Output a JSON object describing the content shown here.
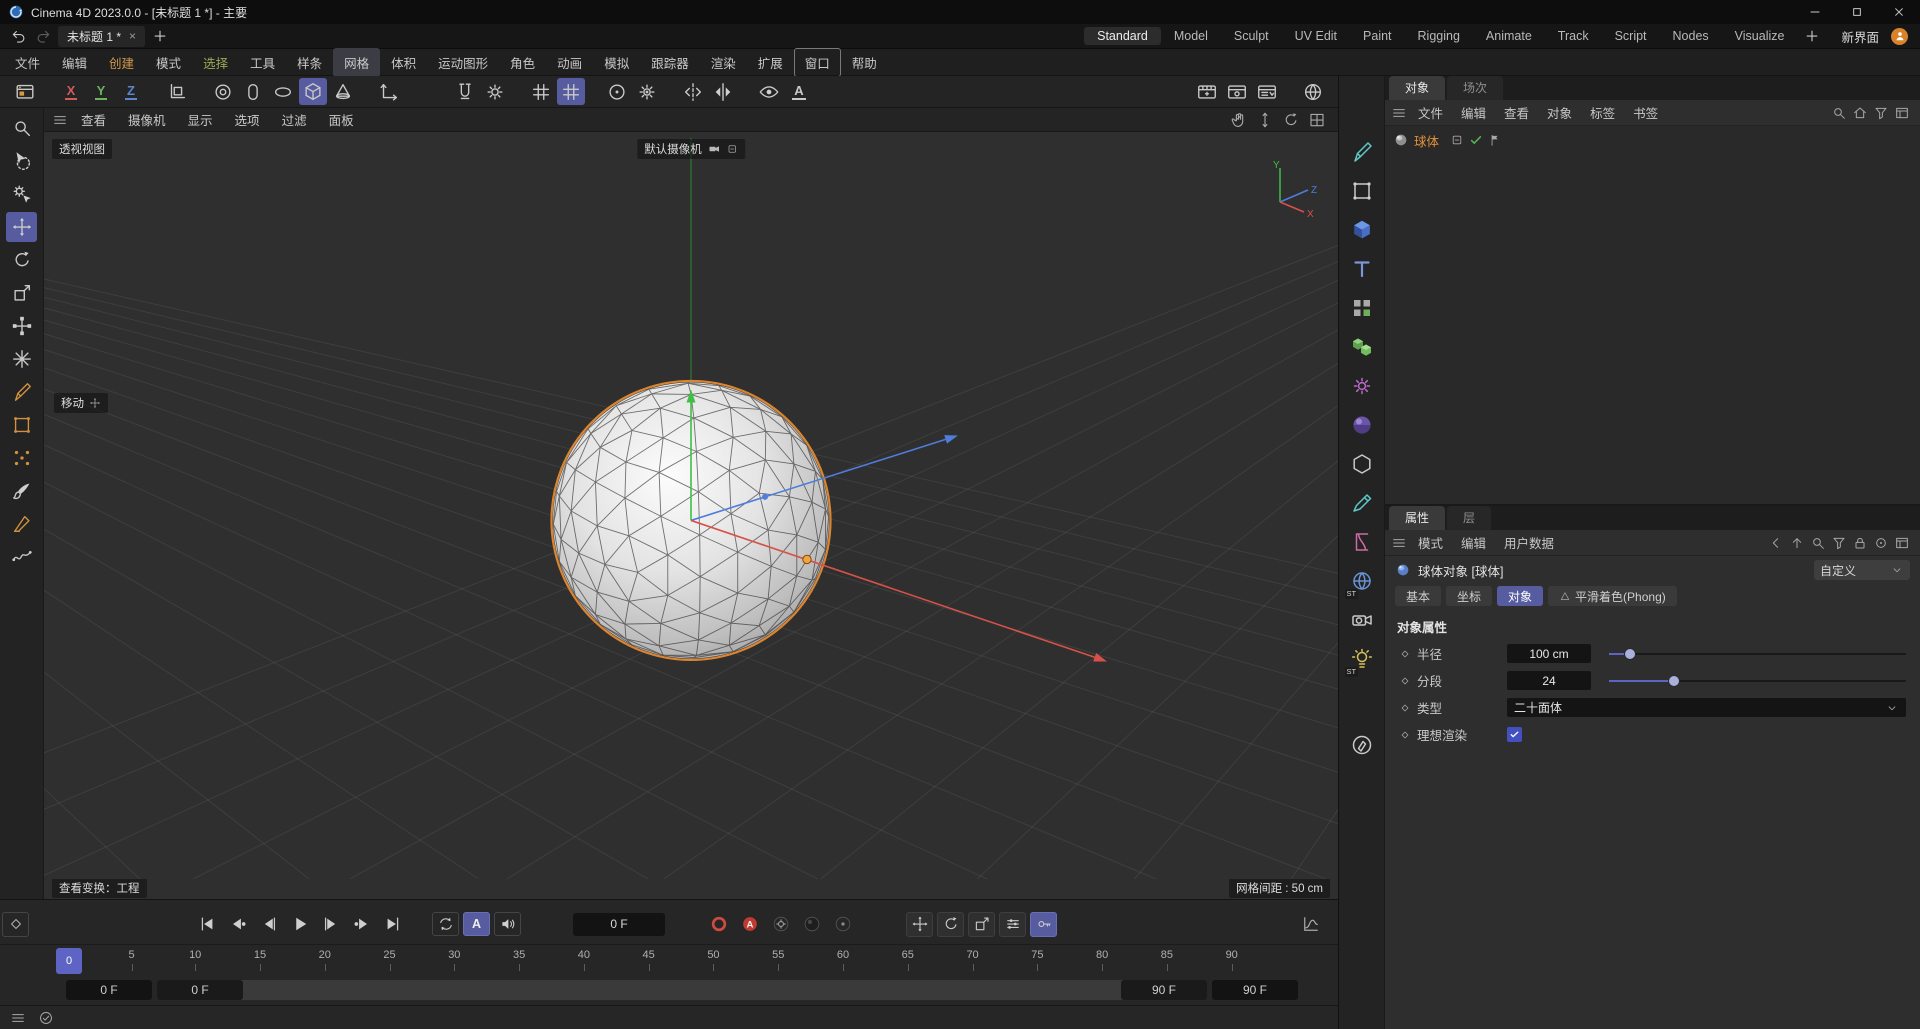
{
  "titlebar": {
    "title": "Cinema 4D 2023.0.0 - [未标题 1 *] - 主要"
  },
  "tabbar": {
    "doc_tab": "未标题 1 *",
    "close": "×",
    "add": "+"
  },
  "layouts": {
    "items": [
      {
        "label": "Standard",
        "active": true
      },
      {
        "label": "Model"
      },
      {
        "label": "Sculpt"
      },
      {
        "label": "UV Edit"
      },
      {
        "label": "Paint"
      },
      {
        "label": "Rigging"
      },
      {
        "label": "Animate"
      },
      {
        "label": "Track"
      },
      {
        "label": "Script"
      },
      {
        "label": "Nodes"
      },
      {
        "label": "Visualize"
      }
    ],
    "new_ui": "新界面"
  },
  "menubar": {
    "items": [
      {
        "label": "文件"
      },
      {
        "label": "编辑"
      },
      {
        "label": "创建",
        "tint": "#cf9a4c"
      },
      {
        "label": "模式"
      },
      {
        "label": "选择",
        "tint": "#9aa855"
      },
      {
        "label": "工具"
      },
      {
        "label": "样条"
      },
      {
        "label": "网格",
        "highlight": true
      },
      {
        "label": "体积"
      },
      {
        "label": "运动图形"
      },
      {
        "label": "角色"
      },
      {
        "label": "动画"
      },
      {
        "label": "模拟"
      },
      {
        "label": "跟踪器"
      },
      {
        "label": "渲染"
      },
      {
        "label": "扩展"
      },
      {
        "label": "窗口",
        "boxed": true
      },
      {
        "label": "帮助"
      }
    ]
  },
  "main_toolbar": {
    "items": [
      {
        "name": "layout-window-icon",
        "icon": "winTool"
      },
      {
        "name": "x-axis-lock-button",
        "letter": "X",
        "color": "#d05c5c",
        "gap": true
      },
      {
        "name": "y-axis-lock-button",
        "letter": "Y",
        "color": "#6cb45a"
      },
      {
        "name": "z-axis-lock-button",
        "letter": "Z",
        "color": "#5c86d0"
      },
      {
        "name": "coordinate-system-button",
        "icon": "coordSys",
        "gap": true
      },
      {
        "name": "ring-select-tool",
        "icon": "torus",
        "gap": true
      },
      {
        "name": "capsule-tool",
        "icon": "capsule"
      },
      {
        "name": "disc-tool",
        "icon": "disc"
      },
      {
        "name": "cube-tool",
        "icon": "cube",
        "selected": true
      },
      {
        "name": "cone-tool",
        "icon": "cone"
      },
      {
        "name": "workplane-button",
        "icon": "coordSys2",
        "gap": true
      },
      {
        "name": "plane-lock-button",
        "icon": "blank"
      },
      {
        "name": "snap-button",
        "icon": "magnet",
        "gap": true
      },
      {
        "name": "snap-settings-button",
        "icon": "gear"
      },
      {
        "name": "grid-snap-button",
        "icon": "grid",
        "gap": true
      },
      {
        "name": "quantize-button",
        "icon": "grid",
        "selected": true
      },
      {
        "name": "modeling-settings-button",
        "icon": "disc2",
        "gap": true
      },
      {
        "name": "tool-settings-button",
        "icon": "gearDot"
      },
      {
        "name": "mirror-button",
        "icon": "mirror",
        "gap": true
      },
      {
        "name": "symmetry-button",
        "icon": "symmetry"
      },
      {
        "name": "solo-eye-button",
        "icon": "eye",
        "gap": true
      },
      {
        "name": "axis-letter-button",
        "letter": "A",
        "color": "#c9c9c9"
      },
      {
        "name": "render-view-button",
        "icon": "filmPlus",
        "push": true
      },
      {
        "name": "render-to-picture-button",
        "icon": "filmGear"
      },
      {
        "name": "render-settings-button",
        "icon": "filmList"
      },
      {
        "name": "render-region-button",
        "icon": "globe",
        "gap": true
      }
    ]
  },
  "left_toolbar": {
    "items": [
      {
        "name": "viewport-zoom-tool",
        "icon": "magnifier"
      },
      {
        "name": "live-selection-tool",
        "icon": "cursorSel"
      },
      {
        "name": "tweak-tool",
        "icon": "gearCursor"
      },
      {
        "name": "move-tool",
        "icon": "move",
        "selected": true
      },
      {
        "name": "rotate-tool",
        "icon": "rotate"
      },
      {
        "name": "scale-tool",
        "icon": "scale"
      },
      {
        "name": "axis-move-tool",
        "icon": "moveAlt"
      },
      {
        "name": "axis-star-tool",
        "icon": "star"
      },
      {
        "name": "spline-pen-tool",
        "icon": "pen",
        "tint": "#d1913f"
      },
      {
        "name": "polygon-tool",
        "icon": "squareO",
        "tint": "#d1913f"
      },
      {
        "name": "points-tool",
        "icon": "dots",
        "tint": "#d1913f"
      },
      {
        "name": "brush-tool",
        "icon": "brush"
      },
      {
        "name": "sketch-pen-tool",
        "icon": "pen2",
        "tint": "#d1913f"
      },
      {
        "name": "spline-smooth-tool",
        "icon": "wave"
      }
    ]
  },
  "viewport": {
    "menu": [
      {
        "label": "查看"
      },
      {
        "label": "摄像机"
      },
      {
        "label": "显示"
      },
      {
        "label": "选项"
      },
      {
        "label": "过滤"
      },
      {
        "label": "面板"
      }
    ],
    "nav": [
      {
        "name": "pan-view-icon",
        "icon": "hand"
      },
      {
        "name": "dolly-view-icon",
        "icon": "dolly"
      },
      {
        "name": "rotate-view-icon",
        "icon": "rotate"
      },
      {
        "name": "toggle-views-icon",
        "icon": "maximizeBox"
      }
    ],
    "view_label": "透视视图",
    "camera_label": "默认摄像机",
    "tool_hint": "移动",
    "info_left": "查看变换：工程",
    "info_right": "网格间距 : 50 cm",
    "axis": {
      "x": "X",
      "y": "Y",
      "z": "Z"
    },
    "axis_colors": {
      "x": "#d85148",
      "y": "#3fbf46",
      "z": "#4f7ddb"
    }
  },
  "palette": {
    "items": [
      {
        "name": "spline-pen-icon",
        "icon": "pen",
        "tint": "#5fc8c8"
      },
      {
        "name": "primitive-plane-icon",
        "icon": "squareO"
      },
      {
        "name": "primitive-cube-icon",
        "icon": "cubeBlue"
      },
      {
        "name": "text-tool-icon",
        "icon": "textT"
      },
      {
        "name": "cloner-icon",
        "icon": "cloner"
      },
      {
        "name": "volume-builder-icon",
        "icon": "greenCubes"
      },
      {
        "name": "simulation-gear-icon",
        "icon": "gear",
        "tint": "#bb6ac9"
      },
      {
        "name": "material-ball-icon",
        "icon": "shaderBall"
      },
      {
        "name": "platonic-icon",
        "icon": "hexagon"
      },
      {
        "name": "modeling-pen-icon",
        "icon": "modelPen",
        "tint": "#5fc8c8"
      },
      {
        "name": "deformer-icon",
        "icon": "deformer",
        "tint": "#cf6aa6"
      },
      {
        "name": "sky-icon",
        "icon": "globe",
        "tint": "#6a93d6",
        "badge": "ST"
      },
      {
        "name": "camera-icon",
        "icon": "camera2"
      },
      {
        "name": "light-icon",
        "icon": "light",
        "tint": "#d6c25b",
        "badge": "ST"
      },
      {
        "name": "palette-spacer",
        "spacer": true
      },
      {
        "name": "draw-tablet-icon",
        "icon": "tablet"
      }
    ]
  },
  "object_manager": {
    "tabs": [
      {
        "label": "对象",
        "active": true
      },
      {
        "label": "场次"
      }
    ],
    "menu": [
      {
        "label": "文件"
      },
      {
        "label": "编辑"
      },
      {
        "label": "查看"
      },
      {
        "label": "对象"
      },
      {
        "label": "标签"
      },
      {
        "label": "书签"
      }
    ],
    "icons": [
      {
        "name": "om-search-icon",
        "icon": "magnifier"
      },
      {
        "name": "om-home-icon",
        "icon": "home"
      },
      {
        "name": "om-filter-icon",
        "icon": "funnel"
      },
      {
        "name": "om-layout-icon",
        "icon": "panel"
      }
    ],
    "objects": [
      {
        "name": "球体"
      }
    ]
  },
  "attribute_manager": {
    "tabs": [
      {
        "label": "属性",
        "active": true
      },
      {
        "label": "层"
      }
    ],
    "menu": [
      {
        "label": "模式"
      },
      {
        "label": "编辑"
      },
      {
        "label": "用户数据"
      }
    ],
    "icons": [
      {
        "name": "am-back-icon",
        "icon": "back"
      },
      {
        "name": "am-up-icon",
        "icon": "up"
      },
      {
        "name": "am-search-icon",
        "icon": "magnifier"
      },
      {
        "name": "am-filter-icon",
        "icon": "funnel"
      },
      {
        "name": "am-lock-icon",
        "icon": "lock"
      },
      {
        "name": "am-focus-icon",
        "icon": "target"
      },
      {
        "name": "am-new-window-icon",
        "icon": "panel"
      }
    ],
    "object_title": "球体对象 [球体]",
    "preset": "自定义",
    "chips": [
      {
        "label": "基本"
      },
      {
        "label": "坐标"
      },
      {
        "label": "对象",
        "active": true
      },
      {
        "label": "平滑着色(Phong)",
        "tag": true
      }
    ],
    "section_title": "对象属性",
    "properties": [
      {
        "label": "半径",
        "value": "100 cm",
        "control": "slider",
        "ratio": 0.07
      },
      {
        "label": "分段",
        "value": "24",
        "control": "slider",
        "ratio": 0.22
      },
      {
        "label": "类型",
        "value": "二十面体",
        "control": "dropdown"
      },
      {
        "label": "理想渲染",
        "control": "checkbox",
        "checked": true
      }
    ]
  },
  "timeline": {
    "transport": [
      {
        "name": "goto-start-button",
        "icon": "gotoStart"
      },
      {
        "name": "previous-key-button",
        "icon": "prevKey"
      },
      {
        "name": "previous-frame-button",
        "icon": "prevFrame"
      },
      {
        "name": "play-button",
        "icon": "play"
      },
      {
        "name": "next-frame-button",
        "icon": "nextFrame"
      },
      {
        "name": "next-key-button",
        "icon": "nextKey"
      },
      {
        "name": "goto-end-button",
        "icon": "gotoEnd"
      }
    ],
    "toggles": [
      {
        "name": "loop-playback-toggle",
        "icon": "loop",
        "bx": true
      },
      {
        "name": "autokey-a-toggle",
        "label": "A",
        "selected": true,
        "bx": true
      },
      {
        "name": "sound-toggle",
        "icon": "speaker"
      }
    ],
    "frame_field": "0 F",
    "record_buttons": [
      {
        "name": "record-keyframe-button",
        "icon": "recRing"
      },
      {
        "name": "autokey-toggle",
        "icon": "recA"
      },
      {
        "name": "keyframe-presets-button",
        "icon": "recGear"
      },
      {
        "name": "record-ball-button",
        "icon": "recBall"
      },
      {
        "name": "record-ring-button",
        "icon": "recDot"
      }
    ],
    "channel_toggles": [
      {
        "name": "record-position-toggle",
        "icon": "move"
      },
      {
        "name": "record-rotation-toggle",
        "icon": "rotate"
      },
      {
        "name": "record-scale-toggle",
        "icon": "scale"
      },
      {
        "name": "record-parameter-toggle",
        "icon": "paramRec"
      },
      {
        "name": "keyframe-selection-toggle",
        "icon": "key",
        "selected": true
      }
    ],
    "ticks": [
      "0",
      "5",
      "10",
      "15",
      "20",
      "25",
      "30",
      "35",
      "40",
      "45",
      "50",
      "55",
      "60",
      "65",
      "70",
      "75",
      "80",
      "85",
      "90"
    ],
    "playhead": "0",
    "range": {
      "min_field": "0 F",
      "start_chip": "0 F",
      "end_chip": "90 F",
      "max_field": "90 F"
    }
  },
  "statusbar": {
    "icons": [
      {
        "name": "status-menu-icon",
        "icon": "hamburger"
      },
      {
        "name": "status-ready-icon",
        "icon": "checkCircle"
      }
    ]
  },
  "colors": {
    "accent": "#565c9f",
    "playhead": "#5d64c4",
    "selection_orange": "#db8531"
  }
}
